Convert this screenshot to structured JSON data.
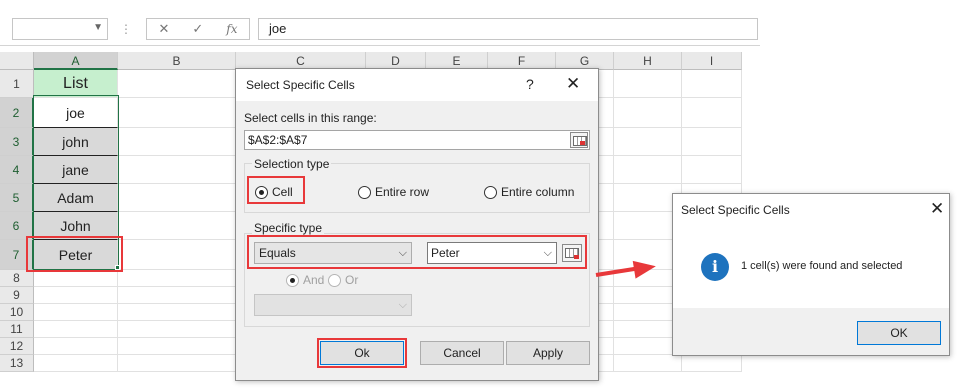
{
  "formula_bar": {
    "name_box": "",
    "cancel_icon": "✕",
    "enter_icon": "✓",
    "fx_label": "fx",
    "formula": "joe"
  },
  "columns": [
    "A",
    "B",
    "C",
    "D",
    "E",
    "F",
    "G",
    "H",
    "I"
  ],
  "rows": [
    "1",
    "2",
    "3",
    "4",
    "5",
    "6",
    "7",
    "8",
    "9",
    "10",
    "11",
    "12",
    "13"
  ],
  "column_a": [
    "List",
    "joe",
    "john",
    "jane",
    "Adam",
    "John",
    "Peter"
  ],
  "dialog": {
    "title": "Select Specific Cells",
    "help": "?",
    "close": "✕",
    "range_label": "Select cells in this range:",
    "range_value": "$A$2:$A$7",
    "selection_type_label": "Selection type",
    "options": [
      "Cell",
      "Entire row",
      "Entire column"
    ],
    "selected_option": "Cell",
    "specific_type_label": "Specific type",
    "condition1": "Equals",
    "value1": "Peter",
    "and_label": "And",
    "or_label": "Or",
    "condition2": "",
    "ok": "Ok",
    "cancel": "Cancel",
    "apply": "Apply"
  },
  "result_dialog": {
    "title": "Select Specific Cells",
    "close": "✕",
    "icon": "i",
    "message": "1 cell(s) were found and selected",
    "ok": "OK"
  },
  "colors": {
    "accent": "#217346",
    "highlight": "#e8383a",
    "header_cell": "#c6efce",
    "info": "#1e73be"
  }
}
